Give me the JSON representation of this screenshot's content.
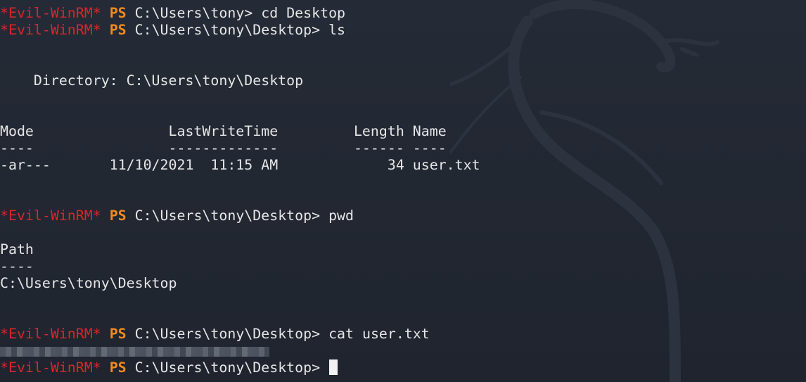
{
  "terminal": {
    "prompt_prefix": "*Evil-WinRM*",
    "prompt_ps": "PS",
    "colors": {
      "background": "#222833",
      "text": "#e6e6e6",
      "prompt_prefix": "#d9262b",
      "prompt_ps": "#f28a1d"
    },
    "background_icon": "kali-dragon-watermark-icon",
    "lines": [
      {
        "kind": "prompt",
        "path": "C:\\Users\\tony>",
        "cmd": "cd Desktop"
      },
      {
        "kind": "prompt",
        "path": "C:\\Users\\tony\\Desktop>",
        "cmd": "ls"
      },
      {
        "kind": "blank"
      },
      {
        "kind": "blank"
      },
      {
        "kind": "output",
        "text": "    Directory: C:\\Users\\tony\\Desktop"
      },
      {
        "kind": "blank"
      },
      {
        "kind": "blank"
      },
      {
        "kind": "output",
        "text": "Mode                LastWriteTime         Length Name"
      },
      {
        "kind": "output",
        "text": "----                -------------         ------ ----"
      },
      {
        "kind": "output",
        "text": "-ar---       11/10/2021  11:15 AM             34 user.txt"
      },
      {
        "kind": "blank"
      },
      {
        "kind": "blank"
      },
      {
        "kind": "prompt",
        "path": "C:\\Users\\tony\\Desktop>",
        "cmd": "pwd"
      },
      {
        "kind": "blank"
      },
      {
        "kind": "output",
        "text": "Path"
      },
      {
        "kind": "output",
        "text": "----"
      },
      {
        "kind": "output",
        "text": "C:\\Users\\tony\\Desktop"
      },
      {
        "kind": "blank"
      },
      {
        "kind": "blank"
      },
      {
        "kind": "prompt",
        "path": "C:\\Users\\tony\\Desktop>",
        "cmd": "cat user.txt"
      },
      {
        "kind": "redacted"
      },
      {
        "kind": "prompt",
        "path": "C:\\Users\\tony\\Desktop>",
        "cmd": "",
        "cursor": true
      }
    ]
  }
}
